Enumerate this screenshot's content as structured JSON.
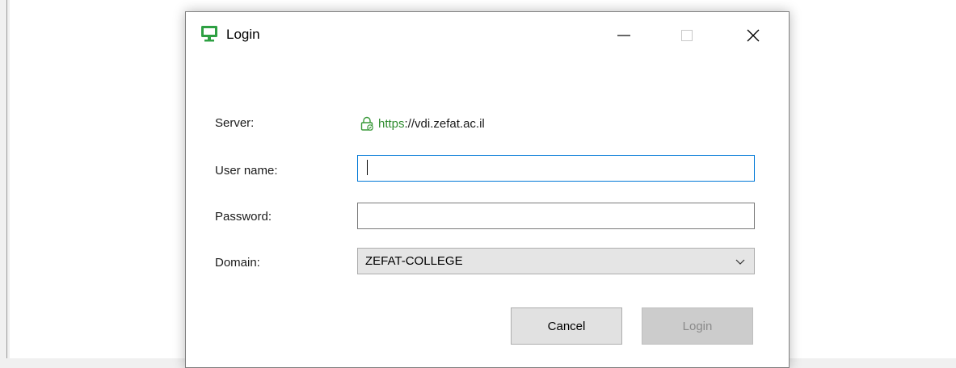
{
  "window": {
    "title": "Login",
    "app_icon": "monitor-icon",
    "controls": {
      "minimize_icon": "minimize-icon",
      "maximize_icon": "maximize-icon",
      "close_icon": "close-icon"
    }
  },
  "form": {
    "server_label": "Server:",
    "server_scheme": "https",
    "server_rest": "://vdi.zefat.ac.il",
    "server_icon": "lock-icon",
    "username_label": "User name:",
    "username_value": "",
    "password_label": "Password:",
    "password_value": "",
    "domain_label": "Domain:",
    "domain_value": "ZEFAT-COLLEGE"
  },
  "buttons": {
    "cancel": "Cancel",
    "login": "Login"
  },
  "colors": {
    "accent": "#0078d7",
    "secure": "#2e8b2e",
    "app_icon": "#2ea043"
  }
}
